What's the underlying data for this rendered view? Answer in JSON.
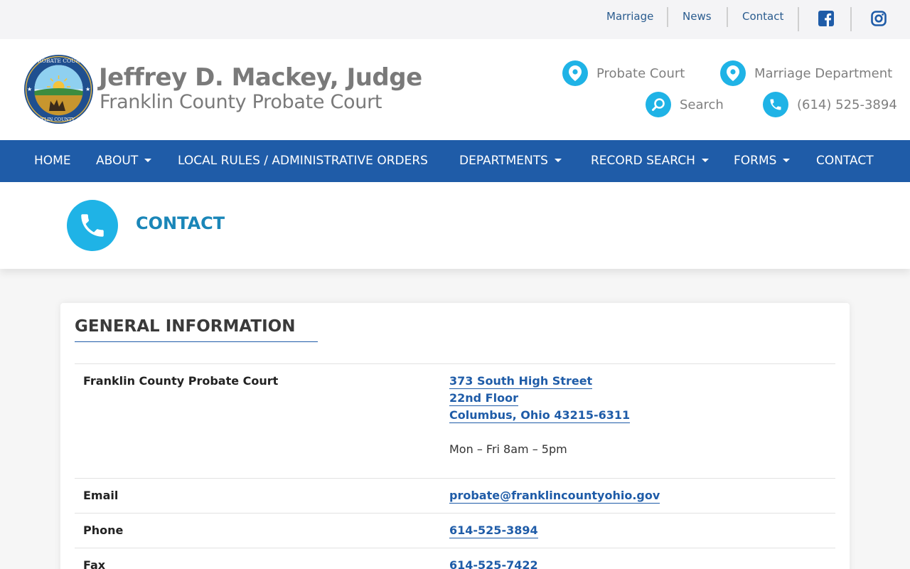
{
  "utility_nav": {
    "links": [
      "Marriage",
      "News",
      "Contact"
    ],
    "social": [
      "facebook-icon",
      "instagram-icon"
    ]
  },
  "header": {
    "judge_name": "Jeffrey D. Mackey, Judge",
    "court_name": "Franklin County Probate Court",
    "seal_top_text": "PROBATE COURT",
    "seal_bottom_text": "FRANKLIN COUNTY, OHIO",
    "quick_links": {
      "probate_court": "Probate Court",
      "marriage_department": "Marriage Department",
      "search": "Search",
      "phone": "(614) 525-3894"
    }
  },
  "main_nav": {
    "home": "HOME",
    "about": "ABOUT",
    "local_rules": "LOCAL RULES / ADMINISTRATIVE ORDERS",
    "departments": "DEPARTMENTS",
    "record_search": "RECORD SEARCH",
    "forms": "FORMS",
    "contact": "CONTACT"
  },
  "page": {
    "title": "CONTACT"
  },
  "general_info": {
    "heading": "GENERAL INFORMATION",
    "court": {
      "label": "Franklin County Probate Court",
      "address_line1": "373 South High Street",
      "address_line2": "22nd Floor",
      "address_line3": "Columbus, Ohio 43215-6311",
      "hours": "Mon – Fri 8am – 5pm"
    },
    "email": {
      "label": "Email",
      "value": "probate@franklincountyohio.gov"
    },
    "phone": {
      "label": "Phone",
      "value": "614-525-3894"
    },
    "fax": {
      "label": "Fax",
      "value": "614-525-7422"
    }
  },
  "colors": {
    "nav_blue": "#1f5ca8",
    "accent_cyan": "#1fb3e6",
    "title_blue": "#1a86b8",
    "link_blue": "#1f5ca8"
  }
}
